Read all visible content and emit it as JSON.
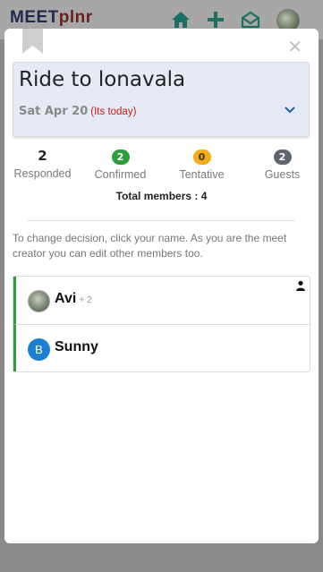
{
  "app": {
    "logo_part1": "MEET",
    "logo_part2": "plnr",
    "icons": [
      "home-icon",
      "plus-icon",
      "mail-open-icon",
      "profile-avatar"
    ]
  },
  "event": {
    "title": "Ride to lonavala",
    "date": "Sat Apr 20",
    "today_label": "(Its today)"
  },
  "stats": [
    {
      "value": "2",
      "label": "Responded",
      "color": null
    },
    {
      "value": "2",
      "label": "Confirmed",
      "color": "#2e9e3c"
    },
    {
      "value": "0",
      "label": "Tentative",
      "color": "#f0ad1c"
    },
    {
      "value": "2",
      "label": "Guests",
      "color": "#5f6670"
    }
  ],
  "total_members": "Total members : 4",
  "hint": "To change decision, click your name. As you are the meet creator you can edit other members too.",
  "members": [
    {
      "name": "Avi",
      "extra": "+ 2",
      "avatar": "photo"
    },
    {
      "name": "Sunny",
      "extra": "",
      "avatar": "B"
    }
  ],
  "colors": {
    "accent_green": "#2e9e3c",
    "accent_blue": "#1d7fd0",
    "today_red": "#c41c1c"
  }
}
